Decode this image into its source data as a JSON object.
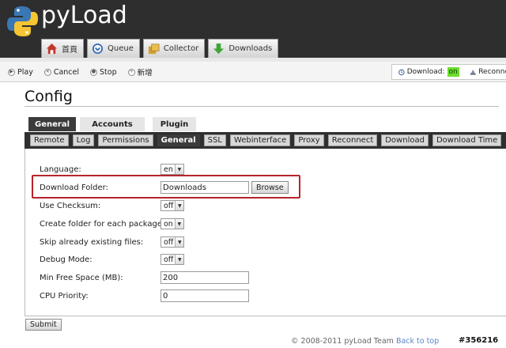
{
  "app": {
    "name": "pyLoad"
  },
  "nav": [
    {
      "label": "首頁",
      "icon": "home-icon"
    },
    {
      "label": "Queue",
      "icon": "queue-icon"
    },
    {
      "label": "Collector",
      "icon": "collector-icon"
    },
    {
      "label": "Downloads",
      "icon": "downloads-icon"
    }
  ],
  "actions": [
    {
      "label": "Play",
      "icon": "play-icon"
    },
    {
      "label": "Cancel",
      "icon": "cancel-icon"
    },
    {
      "label": "Stop",
      "icon": "stop-icon"
    },
    {
      "label": "新增",
      "icon": "add-icon"
    }
  ],
  "status": {
    "download_label": "Download:",
    "download_value": "on",
    "reconnect_label": "Reconne"
  },
  "page": {
    "title": "Config"
  },
  "main_tabs": [
    "General",
    "Accounts",
    "Plugin"
  ],
  "sub_tabs": [
    "Remote",
    "Log",
    "Permissions",
    "General",
    "SSL",
    "Webinterface",
    "Proxy",
    "Reconnect",
    "Download",
    "Download Time"
  ],
  "settings": {
    "language": {
      "label": "Language:",
      "value": "en"
    },
    "download_folder": {
      "label": "Download Folder:",
      "value": "Downloads",
      "browse": "Browse"
    },
    "use_checksum": {
      "label": "Use Checksum:",
      "value": "off"
    },
    "create_folder": {
      "label": "Create folder for each package:",
      "value": "on"
    },
    "skip_existing": {
      "label": "Skip already existing files:",
      "value": "off"
    },
    "debug_mode": {
      "label": "Debug Mode:",
      "value": "off"
    },
    "min_free_space": {
      "label": "Min Free Space (MB):",
      "value": "200"
    },
    "cpu_priority": {
      "label": "CPU Priority:",
      "value": "0"
    }
  },
  "submit_label": "Submit",
  "footer": {
    "copyright": "© 2008-2011 pyLoad Team",
    "back_to_top": "Back to top"
  },
  "watermark": "#356216",
  "colors": {
    "header": "#2e2e2e",
    "active_tab": "#3c3c3c",
    "highlight": "#b8242a",
    "status_on": "#6ddc2e",
    "link": "#5a86c8"
  }
}
